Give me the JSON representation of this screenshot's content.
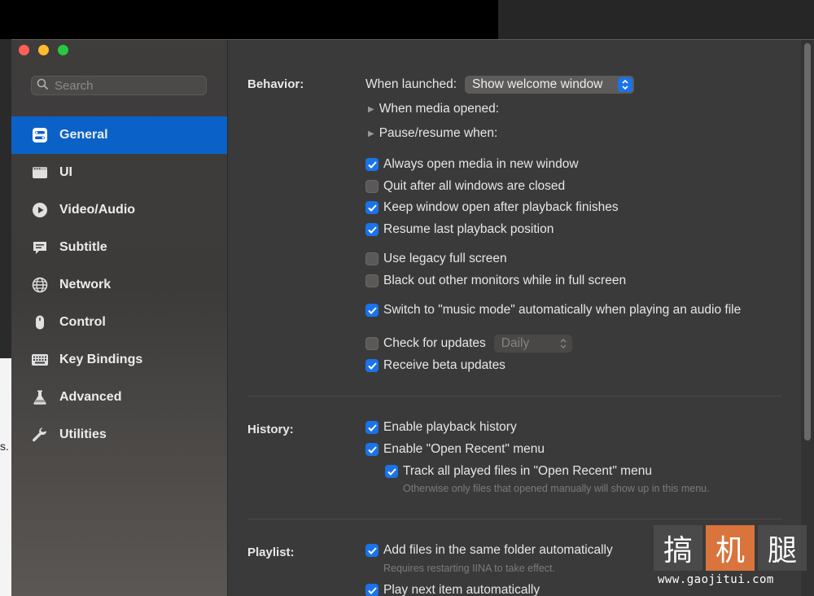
{
  "search": {
    "placeholder": "Search"
  },
  "sidebar": {
    "items": [
      {
        "label": "General",
        "icon": "toggles-icon",
        "active": true
      },
      {
        "label": "UI",
        "icon": "window-icon",
        "active": false
      },
      {
        "label": "Video/Audio",
        "icon": "play-icon",
        "active": false
      },
      {
        "label": "Subtitle",
        "icon": "speech-bubble-icon",
        "active": false
      },
      {
        "label": "Network",
        "icon": "globe-icon",
        "active": false
      },
      {
        "label": "Control",
        "icon": "mouse-icon",
        "active": false
      },
      {
        "label": "Key Bindings",
        "icon": "keyboard-icon",
        "active": false
      },
      {
        "label": "Advanced",
        "icon": "flask-icon",
        "active": false
      },
      {
        "label": "Utilities",
        "icon": "wrench-icon",
        "active": false
      }
    ]
  },
  "behavior": {
    "label": "Behavior:",
    "when_launched_label": "When launched:",
    "when_launched_value": "Show welcome window",
    "when_media_opened": "When media opened:",
    "pause_resume_when": "Pause/resume when:",
    "options": [
      {
        "label": "Always open media in new window",
        "checked": true
      },
      {
        "label": "Quit after all windows are closed",
        "checked": false
      },
      {
        "label": "Keep window open after playback finishes",
        "checked": true
      },
      {
        "label": "Resume last playback position",
        "checked": true
      },
      {
        "label": "Use legacy full screen",
        "checked": false
      },
      {
        "label": "Black out other monitors while in full screen",
        "checked": false
      },
      {
        "label": "Switch to \"music mode\" automatically when playing an audio file",
        "checked": true
      },
      {
        "label": "Check for updates",
        "checked": false
      },
      {
        "label": "Receive beta updates",
        "checked": true
      }
    ],
    "update_frequency": "Daily"
  },
  "history": {
    "label": "History:",
    "options": [
      {
        "label": "Enable playback history",
        "checked": true
      },
      {
        "label": "Enable \"Open Recent\" menu",
        "checked": true
      },
      {
        "label": "Track all played files in \"Open Recent\" menu",
        "checked": true
      }
    ],
    "note": "Otherwise only files that opened manually will show up in this menu."
  },
  "playlist": {
    "label": "Playlist:",
    "options": [
      {
        "label": "Add files in the same folder automatically",
        "checked": true
      },
      {
        "label": "Play next item automatically",
        "checked": true
      }
    ],
    "note": "Requires restarting IINA to take effect."
  },
  "background": {
    "left_edge_char": "s."
  },
  "watermark": {
    "chars": [
      "搞",
      "机",
      "腿"
    ],
    "url": "www.gaojitui.com"
  },
  "colors": {
    "accent": "#1a73e8",
    "selection": "#0a62c8",
    "close": "#ff5f57",
    "minimize": "#febc2e",
    "maximize": "#28c840"
  }
}
